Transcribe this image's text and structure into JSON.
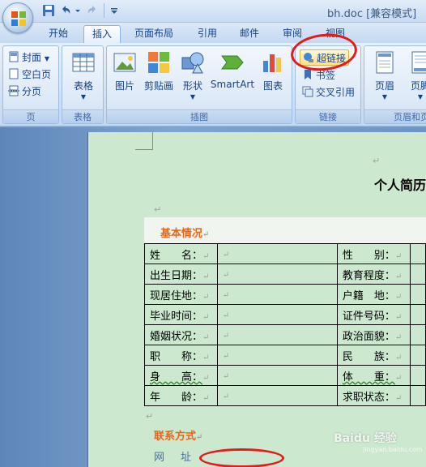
{
  "window": {
    "title": "bh.doc [兼容模式]"
  },
  "tabs": [
    {
      "label": "开始",
      "active": false
    },
    {
      "label": "插入",
      "active": true
    },
    {
      "label": "页面布局",
      "active": false
    },
    {
      "label": "引用",
      "active": false
    },
    {
      "label": "邮件",
      "active": false
    },
    {
      "label": "审阅",
      "active": false
    },
    {
      "label": "视图",
      "active": false
    }
  ],
  "ribbon": {
    "pages": {
      "label": "页",
      "cover": "封面",
      "blank": "空白页",
      "break": "分页"
    },
    "tables": {
      "label": "表格",
      "table": "表格"
    },
    "illustrations": {
      "label": "插图",
      "picture": "图片",
      "clipart": "剪贴画",
      "shapes": "形状",
      "smartart": "SmartArt",
      "chart": "图表"
    },
    "links": {
      "label": "链接",
      "hyperlink": "超链接",
      "bookmark": "书签",
      "crossref": "交叉引用"
    },
    "header_footer": {
      "label": "页眉和页",
      "header": "页眉",
      "footer": "页脚"
    }
  },
  "document": {
    "heading": "个人简历",
    "basic_section": "基本情况",
    "pilcrow": "↵",
    "rows": [
      {
        "l1": "姓　　名：",
        "l2": "性　　别："
      },
      {
        "l1": "出生日期：",
        "l2": "教育程度："
      },
      {
        "l1": "现居住地：",
        "l2": "户籍　地："
      },
      {
        "l1": "毕业时间：",
        "l2": "证件号码："
      },
      {
        "l1": "婚姻状况：",
        "l2": "政治面貌："
      },
      {
        "l1": "职　　称：",
        "l2": "民　　族："
      },
      {
        "l1": "身　　高：",
        "l2": "体　　重："
      },
      {
        "l1": "年　　龄：",
        "l2": "求职状态："
      }
    ],
    "contact_section": "联系方式",
    "website_label": "网址"
  },
  "watermark": {
    "text": "Baidu 经验",
    "sub": "jingyan.baidu.com"
  },
  "colors": {
    "accent_orange": "#e8661a",
    "highlight_red": "#e21b1b",
    "page_green": "#cce8cf",
    "ribbon_blue": "#d3e2f4"
  }
}
